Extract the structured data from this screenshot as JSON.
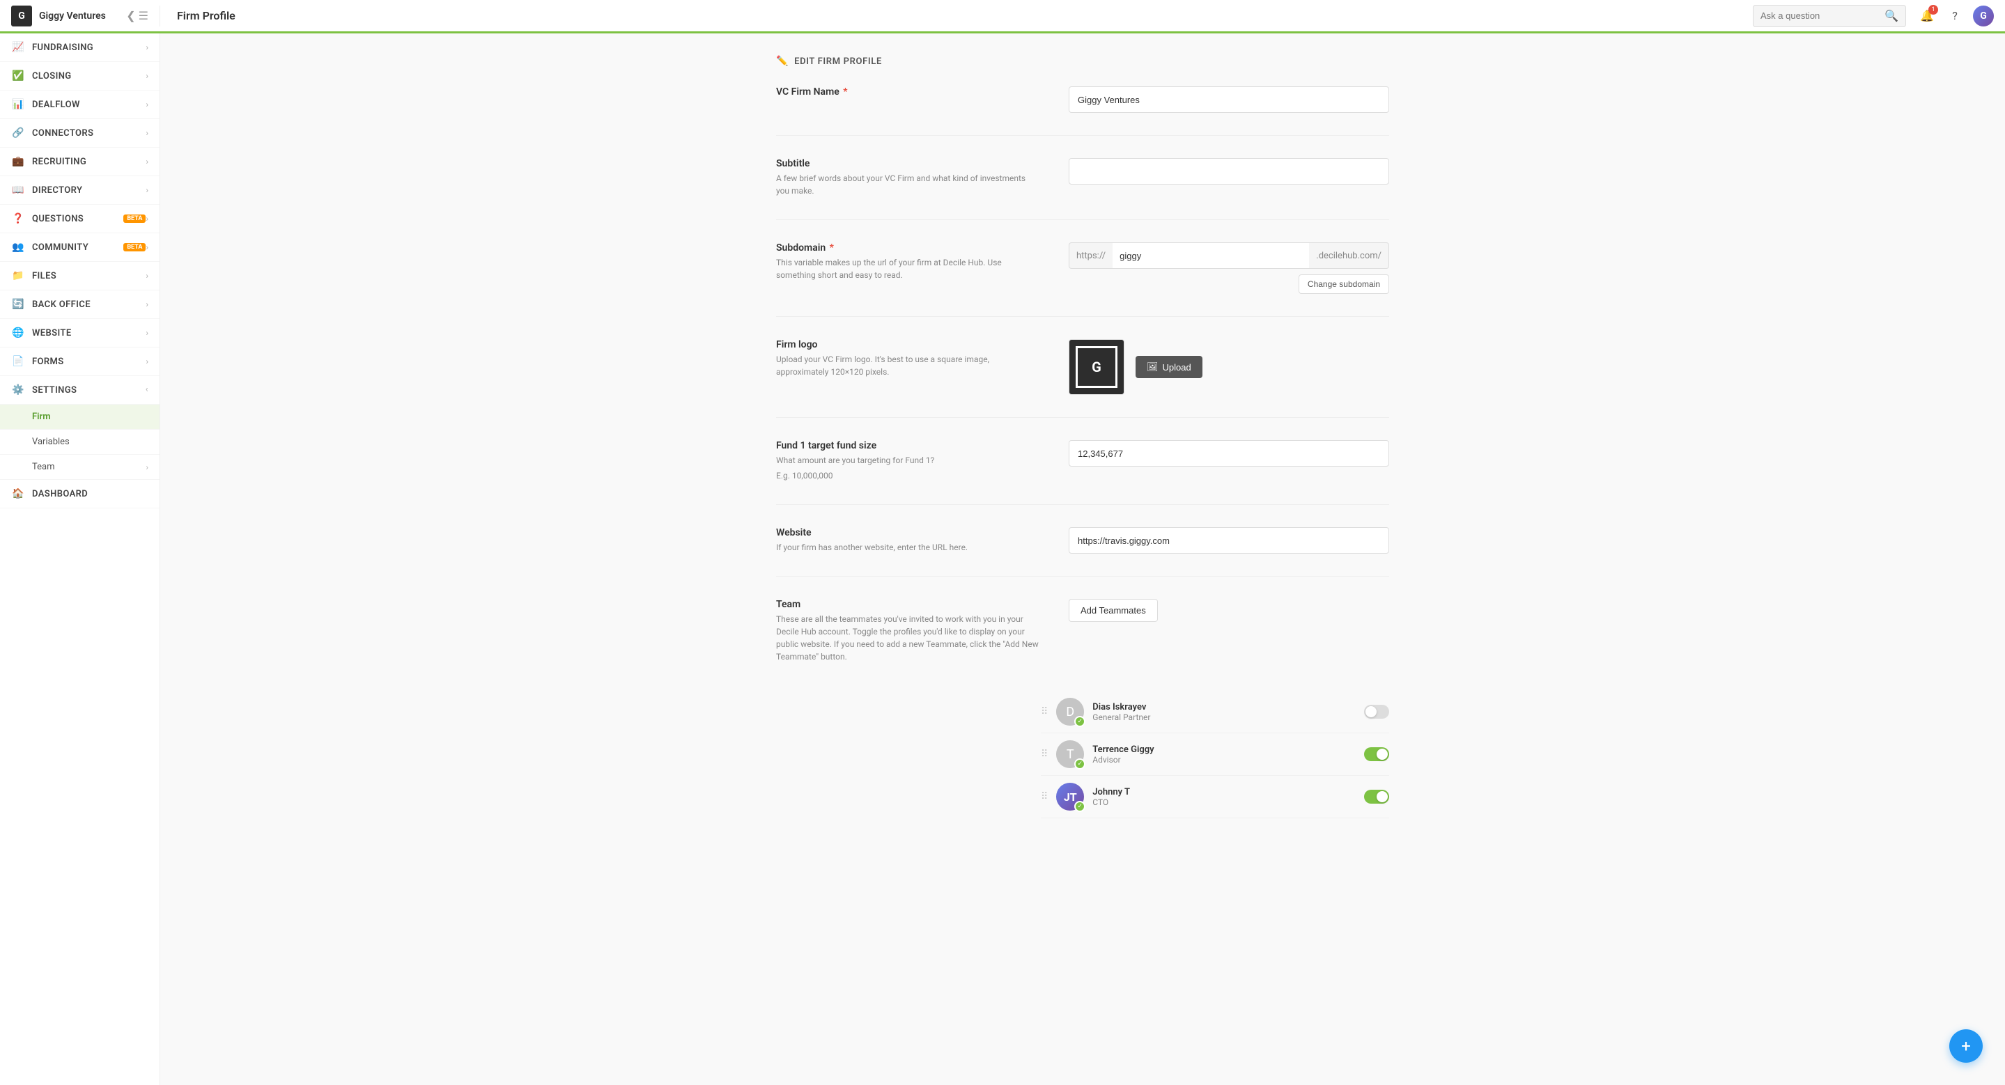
{
  "app": {
    "logo_text": "G",
    "firm_name": "Giggy Ventures"
  },
  "topbar": {
    "page_title": "Firm Profile",
    "search_placeholder": "Ask a question",
    "notification_count": "1"
  },
  "sidebar": {
    "items": [
      {
        "id": "fundraising",
        "label": "FUNDRAISING",
        "icon": "chart",
        "has_chevron": true
      },
      {
        "id": "closing",
        "label": "CLOSING",
        "icon": "check-circle",
        "has_chevron": true
      },
      {
        "id": "dealflow",
        "label": "DEALFLOW",
        "icon": "trending-up",
        "has_chevron": true
      },
      {
        "id": "connectors",
        "label": "CONNECTORS",
        "icon": "link",
        "has_chevron": true
      },
      {
        "id": "recruiting",
        "label": "RECRUITING",
        "icon": "briefcase",
        "has_chevron": true
      },
      {
        "id": "directory",
        "label": "DIRECTORY",
        "icon": "book",
        "has_chevron": true
      },
      {
        "id": "questions",
        "label": "QUESTIONS",
        "icon": "help-circle",
        "has_chevron": true,
        "badge": "BETA"
      },
      {
        "id": "community",
        "label": "COMMUNITY",
        "icon": "users",
        "has_chevron": true,
        "badge": "BETA"
      },
      {
        "id": "files",
        "label": "FILES",
        "icon": "folder",
        "has_chevron": true
      },
      {
        "id": "back-office",
        "label": "BACK OFFICE",
        "icon": "refresh",
        "has_chevron": true
      },
      {
        "id": "website",
        "label": "WEBSITE",
        "icon": "globe",
        "has_chevron": true
      },
      {
        "id": "forms",
        "label": "FORMS",
        "icon": "file-text",
        "has_chevron": true
      },
      {
        "id": "settings",
        "label": "SETTINGS",
        "icon": "settings",
        "has_chevron": true,
        "expanded": true
      }
    ],
    "settings_sub_items": [
      {
        "id": "firm",
        "label": "Firm",
        "active": true
      },
      {
        "id": "variables",
        "label": "Variables"
      },
      {
        "id": "team",
        "label": "Team",
        "has_chevron": true
      }
    ]
  },
  "form": {
    "edit_label": "EDIT FIRM PROFILE",
    "vc_firm_name": {
      "label": "VC Firm Name",
      "required": true,
      "value": "Giggy Ventures"
    },
    "subtitle": {
      "label": "Subtitle",
      "hint": "A few brief words about your VC Firm and what kind of investments you make.",
      "value": ""
    },
    "subdomain": {
      "label": "Subdomain",
      "required": true,
      "hint": "This variable makes up the url of your firm at Decile Hub. Use something short and easy to read.",
      "prefix": "https://",
      "value": "giggy",
      "suffix": ".decilehub.com/",
      "change_btn": "Change subdomain"
    },
    "firm_logo": {
      "label": "Firm logo",
      "hint": "Upload your VC Firm logo. It's best to use a square image, approximately 120×120 pixels.",
      "upload_btn": "Upload"
    },
    "fund_target": {
      "label": "Fund 1 target fund size",
      "hint1": "What amount are you targeting for Fund 1?",
      "hint2": "E.g. 10,000,000",
      "value": "12,345,677"
    },
    "website": {
      "label": "Website",
      "hint": "If your firm has another website, enter the URL here.",
      "value": "https://travis.giggy.com"
    },
    "team": {
      "label": "Team",
      "hint": "These are all the teammates you've invited to work with you in your Decile Hub account. Toggle the profiles you'd like to display on your public website. If you need to add a new Teammate, click the \"Add New Teammate\" button.",
      "add_btn": "Add Teammates",
      "members": [
        {
          "id": "dias",
          "name": "Dias Iskrayev",
          "role": "General Partner",
          "toggle_on": false,
          "has_photo": false,
          "initials": "D"
        },
        {
          "id": "terrence",
          "name": "Terrence Giggy",
          "role": "Advisor",
          "toggle_on": true,
          "has_photo": false,
          "initials": "T"
        },
        {
          "id": "johnny",
          "name": "Johnny T",
          "role": "CTO",
          "toggle_on": true,
          "has_photo": true,
          "initials": "JT"
        }
      ]
    }
  }
}
